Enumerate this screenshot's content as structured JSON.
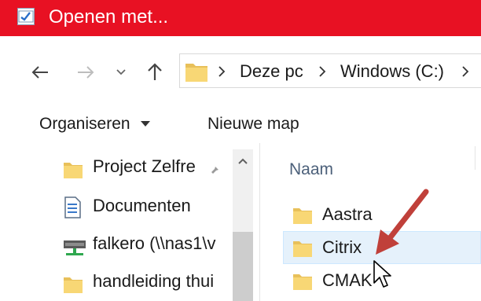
{
  "window": {
    "title": "Openen met...",
    "accent_color": "#e81123"
  },
  "navigation": {
    "back_icon": "arrow-left-icon",
    "forward_icon": "arrow-right-icon",
    "recent_icon": "chevron-down-icon",
    "up_icon": "arrow-up-icon"
  },
  "address": {
    "segments": [
      "Deze pc",
      "Windows (C:)"
    ]
  },
  "toolbar": {
    "organize_label": "Organiseren",
    "new_folder_label": "Nieuwe map"
  },
  "nav_pane": {
    "items": [
      {
        "label": "Project Zelfre",
        "icon": "folder-icon",
        "pinned": true
      },
      {
        "label": "Documenten",
        "icon": "document-icon"
      },
      {
        "label": "falkero (\\\\nas1\\v",
        "icon": "network-drive-icon"
      },
      {
        "label": "handleiding thui",
        "icon": "folder-icon"
      }
    ]
  },
  "file_list": {
    "column_name": "Naam",
    "items": [
      {
        "label": "Aastra",
        "selected": false
      },
      {
        "label": "Citrix",
        "selected": true
      },
      {
        "label": "CMAK",
        "selected": false
      }
    ]
  },
  "annotation": {
    "arrow_color": "#c0403a"
  }
}
